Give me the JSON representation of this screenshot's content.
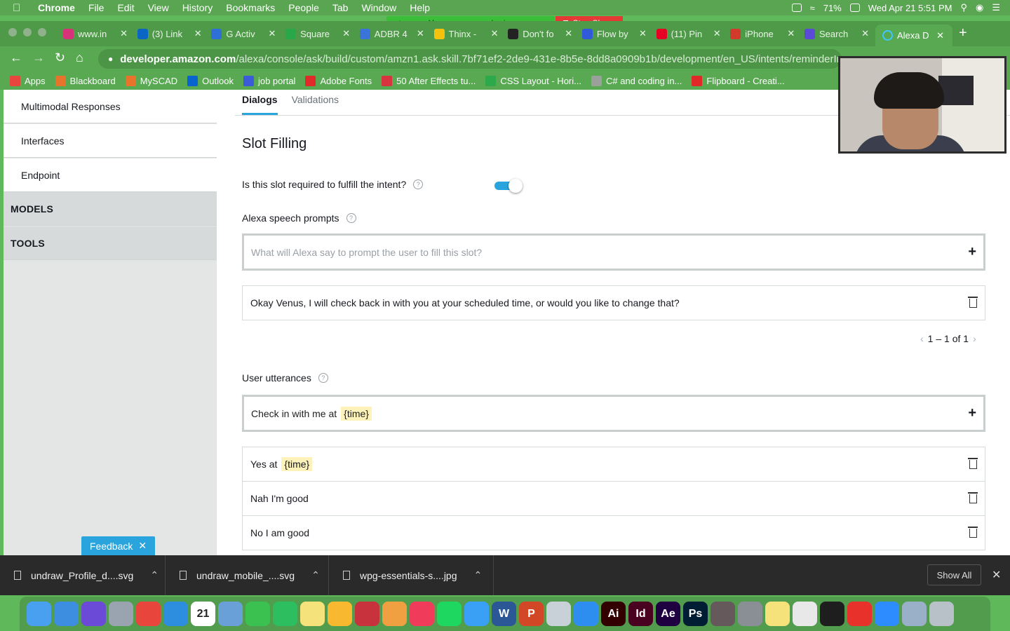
{
  "menubar": {
    "app": "Chrome",
    "menus": [
      "File",
      "Edit",
      "View",
      "History",
      "Bookmarks",
      "People",
      "Tab",
      "Window",
      "Help"
    ],
    "battery": "71%",
    "clock": "Wed Apr 21  5:51 PM"
  },
  "screenshare": {
    "status": "You are screen sharing",
    "stop": "Stop Share"
  },
  "tabs": [
    {
      "label": "www.in",
      "color": "#d6337a"
    },
    {
      "label": "(3) Link",
      "color": "#0a66c2"
    },
    {
      "label": "G Activ",
      "color": "#2f6fd8"
    },
    {
      "label": "Square",
      "color": "#29a84a"
    },
    {
      "label": "ADBR 4",
      "color": "#3b74d8"
    },
    {
      "label": "Thinx -",
      "color": "#f4c20d"
    },
    {
      "label": "Don't fo",
      "color": "#222222"
    },
    {
      "label": "Flow by",
      "color": "#2f5bd8"
    },
    {
      "label": "(11) Pin",
      "color": "#e60023"
    },
    {
      "label": "iPhone",
      "color": "#d23b2b"
    },
    {
      "label": "Search",
      "color": "#5b4ad8"
    }
  ],
  "active_tab": "Alexa D",
  "url": {
    "host": "developer.amazon.com",
    "path": "/alexa/console/ask/build/custom/amzn1.ask.skill.7bf71ef2-2de9-431e-8b5e-8dd8a0909b1b/development/en_US/intents/reminderIn"
  },
  "bookmarks": [
    {
      "label": "Apps",
      "color": "#e8453c"
    },
    {
      "label": "Blackboard",
      "color": "#e8732a"
    },
    {
      "label": "MySCAD",
      "color": "#e8732a"
    },
    {
      "label": "Outlook",
      "color": "#0a64d0"
    },
    {
      "label": "job portal",
      "color": "#3b5bd8"
    },
    {
      "label": "Adobe Fonts",
      "color": "#e12a2a"
    },
    {
      "label": "50 After Effects tu...",
      "color": "#d8343f"
    },
    {
      "label": "CSS Layout - Hori...",
      "color": "#2da84a"
    },
    {
      "label": "C# and coding in...",
      "color": "#9aa09a"
    },
    {
      "label": "Flipboard - Creati...",
      "color": "#e12828"
    }
  ],
  "sidebar": {
    "items": [
      "Multimodal Responses",
      "Interfaces",
      "Endpoint"
    ],
    "groups": [
      "MODELS",
      "TOOLS"
    ]
  },
  "feedback": "Feedback",
  "main": {
    "tabs": [
      "Dialogs",
      "Validations"
    ],
    "section_title": "Slot Filling",
    "required_question": "Is this slot required to fulfill the intent?",
    "required_on": true,
    "prompts_label": "Alexa speech prompts",
    "prompt_placeholder": "What will Alexa say to prompt the user to fill this slot?",
    "prompts": [
      "Okay Venus, I will check back in with you at your scheduled time, or would you like to change that?"
    ],
    "pager": {
      "text": "1 – 1 of 1"
    },
    "utterances_label": "User utterances",
    "utterance_input": {
      "text": "Check in with me at",
      "slot": "{time}"
    },
    "utterances": [
      {
        "text": "Yes at",
        "slot": "{time}"
      },
      {
        "text": "Nah I'm good",
        "slot": ""
      },
      {
        "text": "No I am good",
        "slot": ""
      }
    ]
  },
  "downloads": {
    "files": [
      "undraw_Profile_d....svg",
      "undraw_mobile_....svg",
      "wpg-essentials-s....jpg"
    ],
    "show_all": "Show All"
  },
  "dock": {
    "apps": [
      {
        "name": "messages",
        "color": "#4aa0f0",
        "text": ""
      },
      {
        "name": "finder",
        "color": "#3d8de0",
        "text": ""
      },
      {
        "name": "siri",
        "color": "#6b4ad8",
        "text": ""
      },
      {
        "name": "launchpad",
        "color": "#9aa4b0",
        "text": ""
      },
      {
        "name": "chrome",
        "color": "#e8453c",
        "text": ""
      },
      {
        "name": "safari",
        "color": "#2d8ee0",
        "text": ""
      },
      {
        "name": "calendar",
        "color": "#ffffff",
        "text": "21"
      },
      {
        "name": "preview",
        "color": "#6aa0d8",
        "text": ""
      },
      {
        "name": "facetime",
        "color": "#3ac150",
        "text": ""
      },
      {
        "name": "evernote",
        "color": "#2dbe60",
        "text": ""
      },
      {
        "name": "notes",
        "color": "#f5e27a",
        "text": ""
      },
      {
        "name": "keep",
        "color": "#f8b830",
        "text": ""
      },
      {
        "name": "photo-booth",
        "color": "#c8323c",
        "text": ""
      },
      {
        "name": "photos",
        "color": "#f0a040",
        "text": ""
      },
      {
        "name": "music",
        "color": "#f03c5a",
        "text": ""
      },
      {
        "name": "spotify",
        "color": "#1ed760",
        "text": ""
      },
      {
        "name": "messenger",
        "color": "#3aa0f5",
        "text": ""
      },
      {
        "name": "word",
        "color": "#2b5797",
        "text": "W"
      },
      {
        "name": "powerpoint",
        "color": "#d24726",
        "text": "P"
      },
      {
        "name": "preview-2",
        "color": "#c8d0d8",
        "text": ""
      },
      {
        "name": "app-store",
        "color": "#2d8ef0",
        "text": ""
      },
      {
        "name": "illustrator",
        "color": "#330000",
        "text": "Ai"
      },
      {
        "name": "indesign",
        "color": "#49021f",
        "text": "Id"
      },
      {
        "name": "after-effects",
        "color": "#1f0040",
        "text": "Ae"
      },
      {
        "name": "photoshop",
        "color": "#001d34",
        "text": "Ps"
      },
      {
        "name": "atom",
        "color": "#66595c",
        "text": ""
      },
      {
        "name": "system-preferences",
        "color": "#8a8f96",
        "text": ""
      },
      {
        "name": "stickies",
        "color": "#f5e27a",
        "text": ""
      },
      {
        "name": "slack",
        "color": "#e8e8e8",
        "text": ""
      },
      {
        "name": "figma",
        "color": "#1e1e1e",
        "text": ""
      },
      {
        "name": "acrobat",
        "color": "#e8312a",
        "text": ""
      },
      {
        "name": "zoom",
        "color": "#2d8cff",
        "text": ""
      },
      {
        "name": "image-capture",
        "color": "#9ab0c8",
        "text": ""
      },
      {
        "name": "trash",
        "color": "#b8c0c8",
        "text": ""
      }
    ]
  }
}
